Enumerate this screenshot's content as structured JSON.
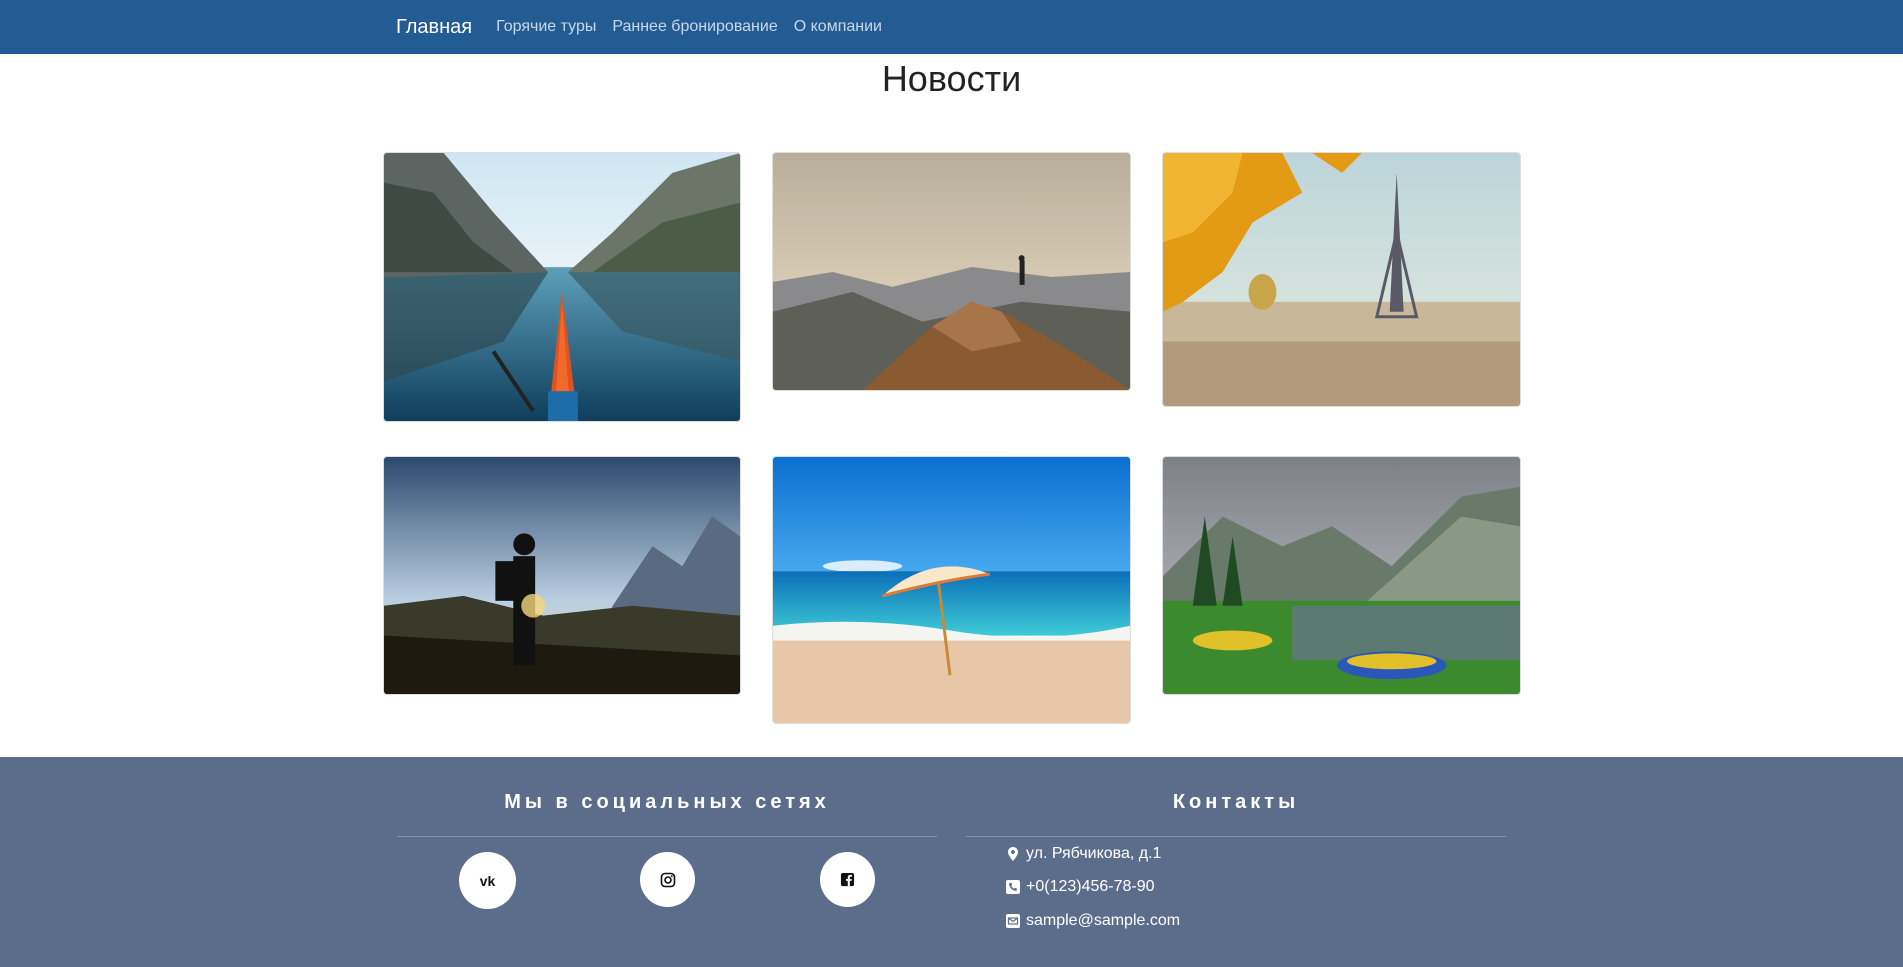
{
  "nav": {
    "brand": "Главная",
    "links": [
      "Горячие туры",
      "Раннее бронирование",
      "О компании"
    ]
  },
  "page": {
    "title": "Новости"
  },
  "gallery": [
    {
      "name": "kayak-fjord-photo"
    },
    {
      "name": "hiker-on-rock-photo"
    },
    {
      "name": "paris-eiffel-photo"
    },
    {
      "name": "hiker-silhouette-photo"
    },
    {
      "name": "beach-umbrella-photo"
    },
    {
      "name": "mountain-lake-boats-photo"
    }
  ],
  "footer": {
    "social_heading": "Мы в социальных сетях",
    "contacts_heading": "Контакты",
    "social": [
      {
        "icon": "vk-icon",
        "label": "VK"
      },
      {
        "icon": "instagram-icon",
        "label": "Instagram"
      },
      {
        "icon": "facebook-icon",
        "label": "Facebook"
      }
    ],
    "contacts": {
      "address": "ул. Рябчикова, д.1",
      "phone": "+0(123)456-78-90",
      "email": "sample@sample.com"
    }
  },
  "colors": {
    "navbar": "#235b93",
    "footer": "#5c6d8c"
  }
}
